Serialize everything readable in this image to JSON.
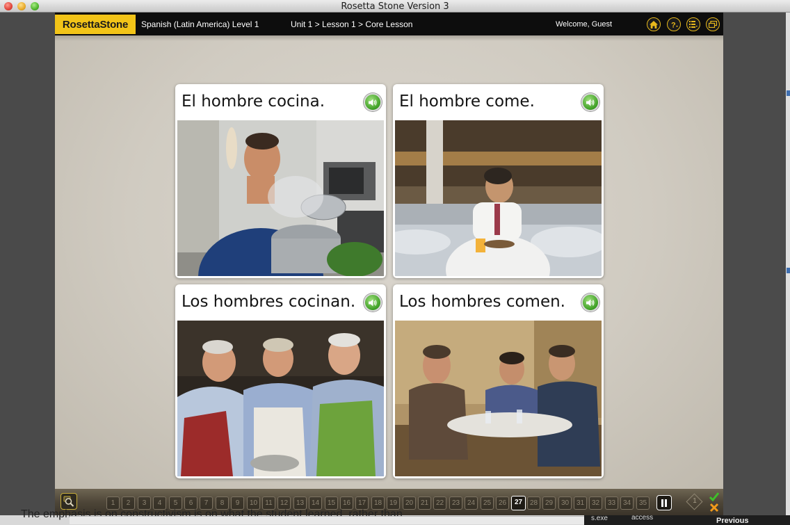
{
  "window": {
    "title": "Rosetta Stone Version 3"
  },
  "header": {
    "logo": "RosettaStone",
    "course": "Spanish (Latin America) Level 1",
    "breadcrumb": "Unit 1 > Lesson 1 > Core Lesson",
    "welcome": "Welcome, Guest",
    "icons": [
      "home-icon",
      "help-icon",
      "list-icon",
      "windows-icon"
    ]
  },
  "cards": [
    {
      "caption": "El hombre cocina.",
      "photo": "man cooking at stove"
    },
    {
      "caption": "El hombre come.",
      "photo": "man eating in cafeteria"
    },
    {
      "caption": "Los hombres cocinan.",
      "photo": "three men cooking in aprons"
    },
    {
      "caption": "Los hombres comen.",
      "photo": "three men eating at table"
    }
  ],
  "navigation": {
    "screens": [
      "1",
      "2",
      "3",
      "4",
      "5",
      "6",
      "7",
      "8",
      "9",
      "10",
      "11",
      "12",
      "13",
      "14",
      "15",
      "16",
      "17",
      "18",
      "19",
      "20",
      "21",
      "22",
      "23",
      "24",
      "25",
      "26",
      "27",
      "28",
      "29",
      "30",
      "31",
      "32",
      "33",
      "34",
      "35"
    ],
    "current_screen": "27",
    "diamond_label": "1"
  },
  "desktop": {
    "background_text": "The emphasis is on constructivism is on what the student learned, rather than",
    "taskbar_items": [
      "s.exe",
      "access",
      "Previous"
    ]
  },
  "colors": {
    "accent": "#f2c418",
    "speaker_green": "#3c9e23",
    "check_green": "#3fbf2a",
    "cross_orange": "#f29a1a"
  }
}
